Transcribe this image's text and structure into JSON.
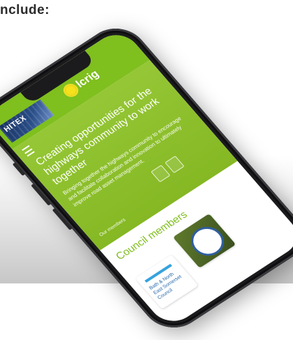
{
  "caption": "nclude:",
  "site": {
    "partner_logo_text": "HITEX",
    "logo_text": "lcrig",
    "hero": {
      "title": "Creating opportunities for the highways community to work together",
      "body": "Bringing together the highways community to encourage and facilitate collaboration and innovation to ultimately improve road asset management.",
      "link": "Our members"
    },
    "members_section": {
      "title": "Council members",
      "cards": [
        {
          "label": "Bath & North East Somerset Council"
        },
        {
          "label": ""
        }
      ]
    }
  },
  "colors": {
    "brand_green": "#8cc225",
    "header_green": "#7fbf1e",
    "logo_yellow": "#f5e21c",
    "member_blue": "#2467a8"
  }
}
